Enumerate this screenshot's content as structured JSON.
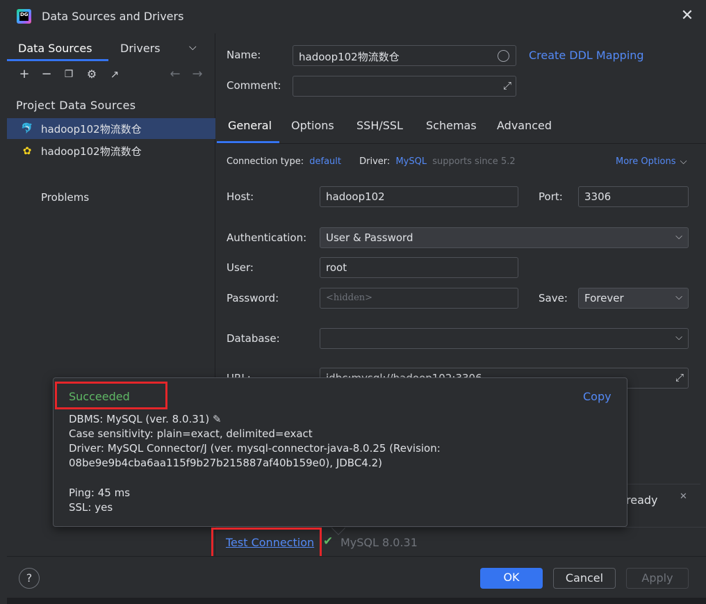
{
  "window": {
    "title": "Data Sources and Drivers",
    "logo_text": "DG"
  },
  "left": {
    "tabs": [
      "Data Sources",
      "Drivers"
    ],
    "section_header": "Project Data Sources",
    "items": [
      {
        "label": "hadoop102物流数仓",
        "icon": "mysql-dolphin-icon",
        "selected": true
      },
      {
        "label": "hadoop102物流数仓",
        "icon": "hive-bee-icon",
        "selected": false
      }
    ],
    "problems_label": "Problems"
  },
  "main": {
    "name_label": "Name:",
    "name_value": "hadoop102物流数仓",
    "create_ddl_link": "Create DDL Mapping",
    "comment_label": "Comment:",
    "tabs": [
      "General",
      "Options",
      "SSH/SSL",
      "Schemas",
      "Advanced"
    ],
    "connection_type_label": "Connection type:",
    "connection_type_value": "default",
    "driver_label": "Driver:",
    "driver_value": "MySQL",
    "driver_note": "supports since 5.2",
    "more_options": "More Options",
    "host_label": "Host:",
    "host_value": "hadoop102",
    "port_label": "Port:",
    "port_value": "3306",
    "auth_label": "Authentication:",
    "auth_value": "User & Password",
    "user_label": "User:",
    "user_value": "root",
    "password_label": "Password:",
    "password_placeholder": "<hidden>",
    "save_label": "Save:",
    "save_value": "Forever",
    "database_label": "Database:",
    "database_value": "",
    "url_label": "URL:",
    "url_value": "jdbc:mysql://hadoop102:3306",
    "status_fragment": "ready"
  },
  "popup": {
    "status": "Succeeded",
    "copy_label": "Copy",
    "dbms": "DBMS: MySQL (ver. 8.0.31)",
    "case_sensitivity": "Case sensitivity: plain=exact, delimited=exact",
    "driver_line1": "Driver: MySQL Connector/J (ver. mysql-connector-java-8.0.25 (Revision:",
    "driver_line2": "08be9e9b4cba6aa115f9b27b215887af40b159e0), JDBC4.2)",
    "ping": "Ping: 45 ms",
    "ssl": "SSL: yes"
  },
  "footer": {
    "test_connection": "Test Connection",
    "test_result": "MySQL 8.0.31",
    "ok": "OK",
    "cancel": "Cancel",
    "apply": "Apply",
    "help": "?"
  },
  "colors": {
    "accent": "#3574f0",
    "link": "#548af7",
    "success": "#5fb865",
    "highlight_box": "#e5262a"
  }
}
